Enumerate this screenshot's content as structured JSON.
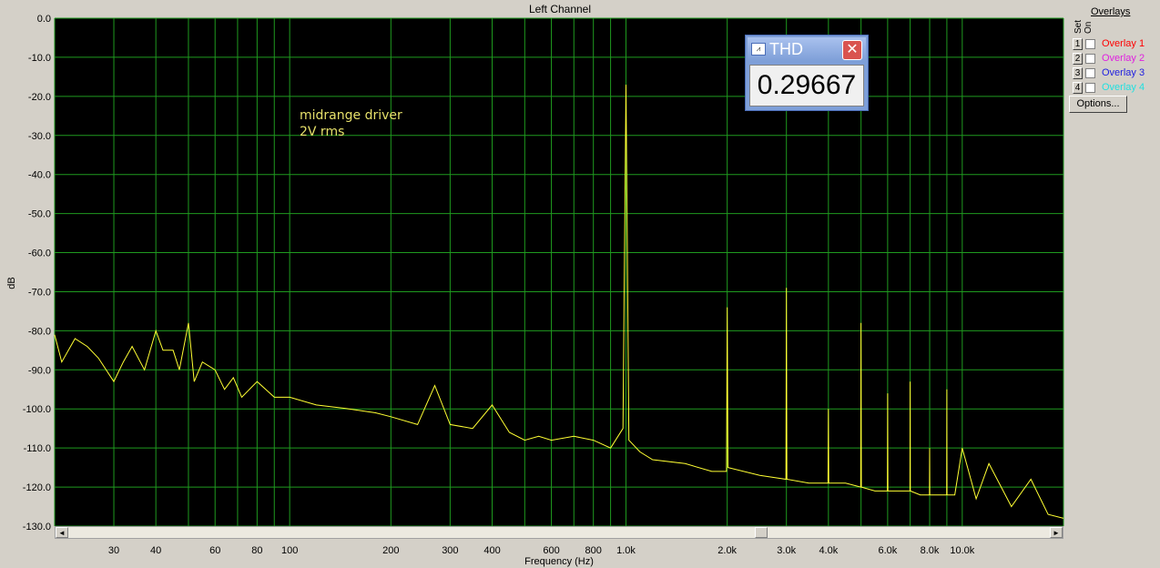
{
  "window": {
    "title": "Left Channel"
  },
  "chart_data": {
    "type": "line",
    "title": "Left Channel",
    "xlabel": "Frequency (Hz)",
    "ylabel": "dB",
    "xscale": "log",
    "xlim": [
      20,
      20000
    ],
    "ylim": [
      -130,
      0
    ],
    "grid": true,
    "background": "#000000",
    "grid_color": "#1f9a1f",
    "line_color": "#ffff33",
    "y_ticks": [
      "0.0",
      "-10.0",
      "-20.0",
      "-30.0",
      "-40.0",
      "-50.0",
      "-60.0",
      "-70.0",
      "-80.0",
      "-90.0",
      "-100.0",
      "-110.0",
      "-120.0",
      "-130.0"
    ],
    "x_ticks": [
      {
        "value": 30,
        "label": "30"
      },
      {
        "value": 40,
        "label": "40"
      },
      {
        "value": 60,
        "label": "60"
      },
      {
        "value": 80,
        "label": "80"
      },
      {
        "value": 100,
        "label": "100"
      },
      {
        "value": 200,
        "label": "200"
      },
      {
        "value": 300,
        "label": "300"
      },
      {
        "value": 400,
        "label": "400"
      },
      {
        "value": 600,
        "label": "600"
      },
      {
        "value": 800,
        "label": "800"
      },
      {
        "value": 1000,
        "label": "1.0k"
      },
      {
        "value": 2000,
        "label": "2.0k"
      },
      {
        "value": 3000,
        "label": "3.0k"
      },
      {
        "value": 4000,
        "label": "4.0k"
      },
      {
        "value": 6000,
        "label": "6.0k"
      },
      {
        "value": 8000,
        "label": "8.0k"
      },
      {
        "value": 10000,
        "label": "10.0k"
      }
    ],
    "annotations": [
      "midrange driver",
      "2V rms"
    ],
    "series": [
      {
        "points": [
          [
            20,
            -81
          ],
          [
            21,
            -88
          ],
          [
            23,
            -82
          ],
          [
            25,
            -84
          ],
          [
            27,
            -87
          ],
          [
            30,
            -93
          ],
          [
            32,
            -88
          ],
          [
            34,
            -84
          ],
          [
            37,
            -90
          ],
          [
            40,
            -80
          ],
          [
            42,
            -85
          ],
          [
            45,
            -85
          ],
          [
            47,
            -90
          ],
          [
            50,
            -78
          ],
          [
            52,
            -93
          ],
          [
            55,
            -88
          ],
          [
            60,
            -90
          ],
          [
            64,
            -95
          ],
          [
            68,
            -92
          ],
          [
            72,
            -97
          ],
          [
            80,
            -93
          ],
          [
            90,
            -97
          ],
          [
            100,
            -97
          ],
          [
            120,
            -99
          ],
          [
            150,
            -100
          ],
          [
            180,
            -101
          ],
          [
            200,
            -102
          ],
          [
            240,
            -104
          ],
          [
            270,
            -94
          ],
          [
            300,
            -104
          ],
          [
            350,
            -105
          ],
          [
            400,
            -99
          ],
          [
            450,
            -106
          ],
          [
            500,
            -108
          ],
          [
            550,
            -107
          ],
          [
            600,
            -108
          ],
          [
            700,
            -107
          ],
          [
            800,
            -108
          ],
          [
            900,
            -110
          ],
          [
            980,
            -105
          ],
          [
            1000,
            -17
          ],
          [
            1020,
            -108
          ],
          [
            1100,
            -111
          ],
          [
            1200,
            -113
          ],
          [
            1500,
            -114
          ],
          [
            1800,
            -116
          ],
          [
            1990,
            -116
          ],
          [
            2000,
            -74
          ],
          [
            2010,
            -115
          ],
          [
            2500,
            -117
          ],
          [
            2990,
            -118
          ],
          [
            3000,
            -69
          ],
          [
            3010,
            -118
          ],
          [
            3500,
            -119
          ],
          [
            3990,
            -119
          ],
          [
            4000,
            -100
          ],
          [
            4010,
            -119
          ],
          [
            4500,
            -119
          ],
          [
            4990,
            -120
          ],
          [
            5000,
            -78
          ],
          [
            5010,
            -120
          ],
          [
            5500,
            -121
          ],
          [
            5990,
            -121
          ],
          [
            6000,
            -96
          ],
          [
            6010,
            -121
          ],
          [
            6500,
            -121
          ],
          [
            6990,
            -121
          ],
          [
            7000,
            -93
          ],
          [
            7010,
            -121
          ],
          [
            7500,
            -122
          ],
          [
            7990,
            -122
          ],
          [
            8000,
            -110
          ],
          [
            8010,
            -122
          ],
          [
            8990,
            -122
          ],
          [
            9000,
            -95
          ],
          [
            9010,
            -122
          ],
          [
            9500,
            -122
          ],
          [
            10000,
            -110
          ],
          [
            11000,
            -123
          ],
          [
            12000,
            -114
          ],
          [
            14000,
            -125
          ],
          [
            16000,
            -118
          ],
          [
            18000,
            -127
          ],
          [
            20000,
            -128
          ]
        ]
      }
    ]
  },
  "thd": {
    "title": "THD",
    "value": "0.29667 %",
    "close_label": "✕",
    "icon": "graph-icon"
  },
  "overlays": {
    "title": "Overlays",
    "set_label": "Set",
    "on_label": "On",
    "items": [
      {
        "num": "1",
        "label": "Overlay 1",
        "color": "#ff0000"
      },
      {
        "num": "2",
        "label": "Overlay 2",
        "color": "#e020e0"
      },
      {
        "num": "3",
        "label": "Overlay 3",
        "color": "#2020e0"
      },
      {
        "num": "4",
        "label": "Overlay 4",
        "color": "#20e0e0"
      }
    ],
    "options_label": "Options..."
  },
  "scrollbar": {
    "left_arrow": "◄",
    "right_arrow": "►"
  },
  "toolbar": {
    "icon": "sine-wave-icon"
  }
}
